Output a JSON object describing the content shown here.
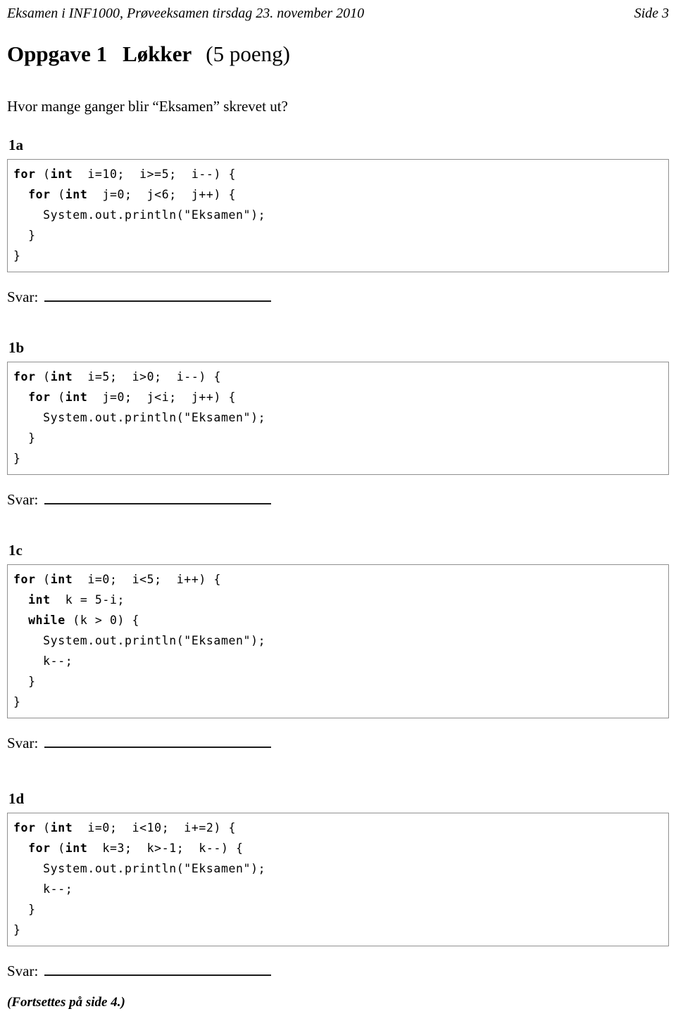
{
  "header": {
    "left": "Eksamen i INF1000, Prøveeksamen tirsdag 23. november 2010",
    "right": "Side 3"
  },
  "title": {
    "task": "Oppgave 1",
    "topic": "Løkker",
    "points": "(5 poeng)"
  },
  "intro": "Hvor mange ganger blir “Eksamen” skrevet ut?",
  "answer_label": "Svar:",
  "subtasks": [
    {
      "label": "1a",
      "code_lines": [
        {
          "indent": 0,
          "parts": [
            {
              "t": "for",
              "bold": true
            },
            {
              "t": " (",
              "bold": false
            },
            {
              "t": "int",
              "bold": true
            },
            {
              "t": "  i=10;  i>=5;  i--) {",
              "bold": false
            }
          ]
        },
        {
          "indent": 1,
          "parts": [
            {
              "t": "for",
              "bold": true
            },
            {
              "t": " (",
              "bold": false
            },
            {
              "t": "int",
              "bold": true
            },
            {
              "t": "  j=0;  j<6;  j++) {",
              "bold": false
            }
          ]
        },
        {
          "indent": 2,
          "parts": [
            {
              "t": "System.out.println(\"Eksamen\");",
              "bold": false
            }
          ]
        },
        {
          "indent": 1,
          "parts": [
            {
              "t": "}",
              "bold": false
            }
          ]
        },
        {
          "indent": 0,
          "parts": [
            {
              "t": "}",
              "bold": false
            }
          ]
        }
      ]
    },
    {
      "label": "1b",
      "code_lines": [
        {
          "indent": 0,
          "parts": [
            {
              "t": "for",
              "bold": true
            },
            {
              "t": " (",
              "bold": false
            },
            {
              "t": "int",
              "bold": true
            },
            {
              "t": "  i=5;  i>0;  i--) {",
              "bold": false
            }
          ]
        },
        {
          "indent": 1,
          "parts": [
            {
              "t": "for",
              "bold": true
            },
            {
              "t": " (",
              "bold": false
            },
            {
              "t": "int",
              "bold": true
            },
            {
              "t": "  j=0;  j<i;  j++) {",
              "bold": false
            }
          ]
        },
        {
          "indent": 2,
          "parts": [
            {
              "t": "System.out.println(\"Eksamen\");",
              "bold": false
            }
          ]
        },
        {
          "indent": 1,
          "parts": [
            {
              "t": "}",
              "bold": false
            }
          ]
        },
        {
          "indent": 0,
          "parts": [
            {
              "t": "}",
              "bold": false
            }
          ]
        }
      ]
    },
    {
      "label": "1c",
      "code_lines": [
        {
          "indent": 0,
          "parts": [
            {
              "t": "for",
              "bold": true
            },
            {
              "t": " (",
              "bold": false
            },
            {
              "t": "int",
              "bold": true
            },
            {
              "t": "  i=0;  i<5;  i++) {",
              "bold": false
            }
          ]
        },
        {
          "indent": 1,
          "parts": [
            {
              "t": "int",
              "bold": true
            },
            {
              "t": "  k = 5-i;",
              "bold": false
            }
          ]
        },
        {
          "indent": 1,
          "parts": [
            {
              "t": "while",
              "bold": true
            },
            {
              "t": " (k > 0) {",
              "bold": false
            }
          ]
        },
        {
          "indent": 2,
          "parts": [
            {
              "t": "System.out.println(\"Eksamen\");",
              "bold": false
            }
          ]
        },
        {
          "indent": 2,
          "parts": [
            {
              "t": "k--;",
              "bold": false
            }
          ]
        },
        {
          "indent": 1,
          "parts": [
            {
              "t": "}",
              "bold": false
            }
          ]
        },
        {
          "indent": 0,
          "parts": [
            {
              "t": "}",
              "bold": false
            }
          ]
        }
      ]
    },
    {
      "label": "1d",
      "code_lines": [
        {
          "indent": 0,
          "parts": [
            {
              "t": "for",
              "bold": true
            },
            {
              "t": " (",
              "bold": false
            },
            {
              "t": "int",
              "bold": true
            },
            {
              "t": "  i=0;  i<10;  i+=2) {",
              "bold": false
            }
          ]
        },
        {
          "indent": 1,
          "parts": [
            {
              "t": "for",
              "bold": true
            },
            {
              "t": " (",
              "bold": false
            },
            {
              "t": "int",
              "bold": true
            },
            {
              "t": "  k=3;  k>-1;  k--) {",
              "bold": false
            }
          ]
        },
        {
          "indent": 2,
          "parts": [
            {
              "t": "System.out.println(\"Eksamen\");",
              "bold": false
            }
          ]
        },
        {
          "indent": 2,
          "parts": [
            {
              "t": "k--;",
              "bold": false
            }
          ]
        },
        {
          "indent": 1,
          "parts": [
            {
              "t": "}",
              "bold": false
            }
          ]
        },
        {
          "indent": 0,
          "parts": [
            {
              "t": "}",
              "bold": false
            }
          ]
        }
      ]
    }
  ],
  "footnote": "(Fortsettes på side 4.)"
}
